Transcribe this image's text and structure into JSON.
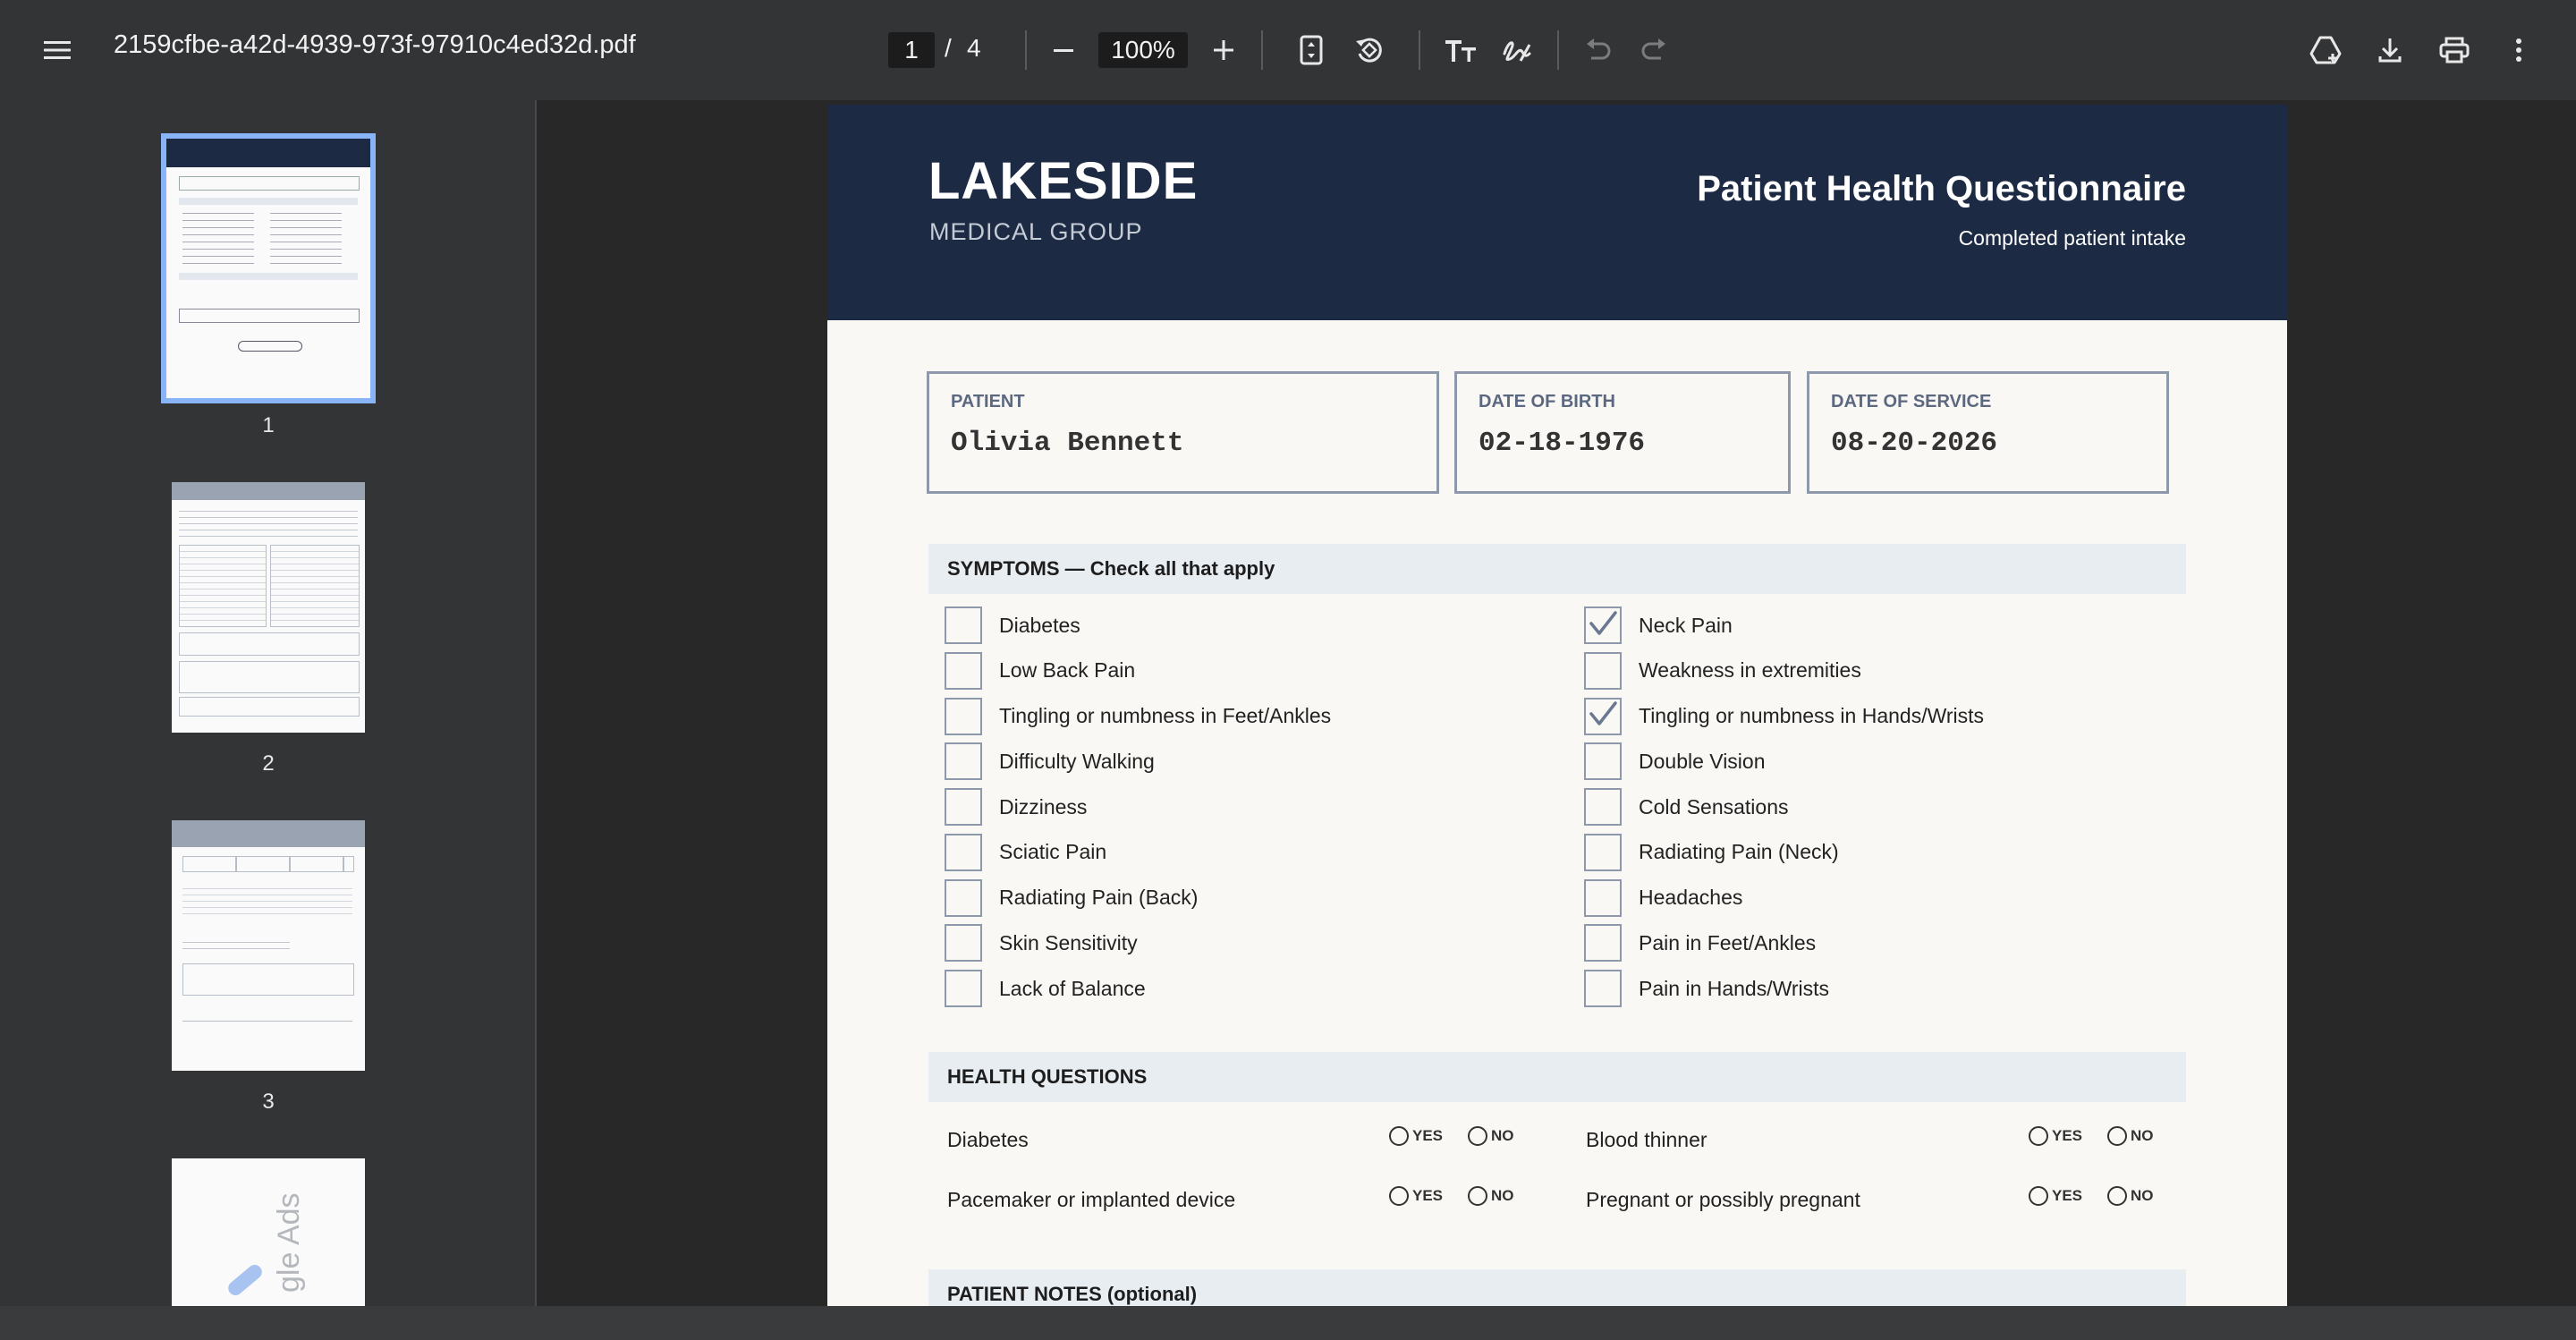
{
  "toolbar": {
    "file_name": "2159cfbe-a42d-4939-973f-97910c4ed32d.pdf",
    "current_page": "1",
    "page_separator": "/",
    "total_pages": "4",
    "zoom": "100%"
  },
  "sidebar": {
    "thumbnails": [
      {
        "label": "1"
      },
      {
        "label": "2"
      },
      {
        "label": "3"
      }
    ],
    "thumb4_text": "gle Ads"
  },
  "document": {
    "org_name": "LAKESIDE",
    "org_sub": "MEDICAL GROUP",
    "title": "Patient Health Questionnaire",
    "subtitle": "Completed patient intake",
    "patient": {
      "label": "PATIENT",
      "value": "Olivia Bennett"
    },
    "dob": {
      "label": "DATE OF BIRTH",
      "value": "02-18-1976"
    },
    "dos": {
      "label": "DATE OF SERVICE",
      "value": "08-20-2026"
    },
    "symptoms": {
      "heading": "SYMPTOMS  —  Check all that apply",
      "left": [
        {
          "label": "Diabetes",
          "checked": false
        },
        {
          "label": "Low Back Pain",
          "checked": false
        },
        {
          "label": "Tingling or numbness in Feet/Ankles",
          "checked": false
        },
        {
          "label": "Difficulty Walking",
          "checked": false
        },
        {
          "label": "Dizziness",
          "checked": false
        },
        {
          "label": "Sciatic Pain",
          "checked": false
        },
        {
          "label": "Radiating Pain (Back)",
          "checked": false
        },
        {
          "label": "Skin Sensitivity",
          "checked": false
        },
        {
          "label": "Lack of Balance",
          "checked": false
        }
      ],
      "right": [
        {
          "label": "Neck Pain",
          "checked": true
        },
        {
          "label": "Weakness in extremities",
          "checked": false
        },
        {
          "label": "Tingling or numbness in Hands/Wrists",
          "checked": true
        },
        {
          "label": "Double Vision",
          "checked": false
        },
        {
          "label": "Cold Sensations",
          "checked": false
        },
        {
          "label": "Radiating Pain (Neck)",
          "checked": false
        },
        {
          "label": "Headaches",
          "checked": false
        },
        {
          "label": "Pain in Feet/Ankles",
          "checked": false
        },
        {
          "label": "Pain in Hands/Wrists",
          "checked": false
        }
      ]
    },
    "health_questions": {
      "heading": "HEALTH QUESTIONS",
      "yes_label": "YES",
      "no_label": "NO",
      "items": [
        {
          "label": "Diabetes"
        },
        {
          "label": "Blood thinner"
        },
        {
          "label": "Pacemaker or implanted device"
        },
        {
          "label": "Pregnant or possibly pregnant"
        }
      ]
    },
    "notes_heading": "PATIENT NOTES (optional)"
  }
}
